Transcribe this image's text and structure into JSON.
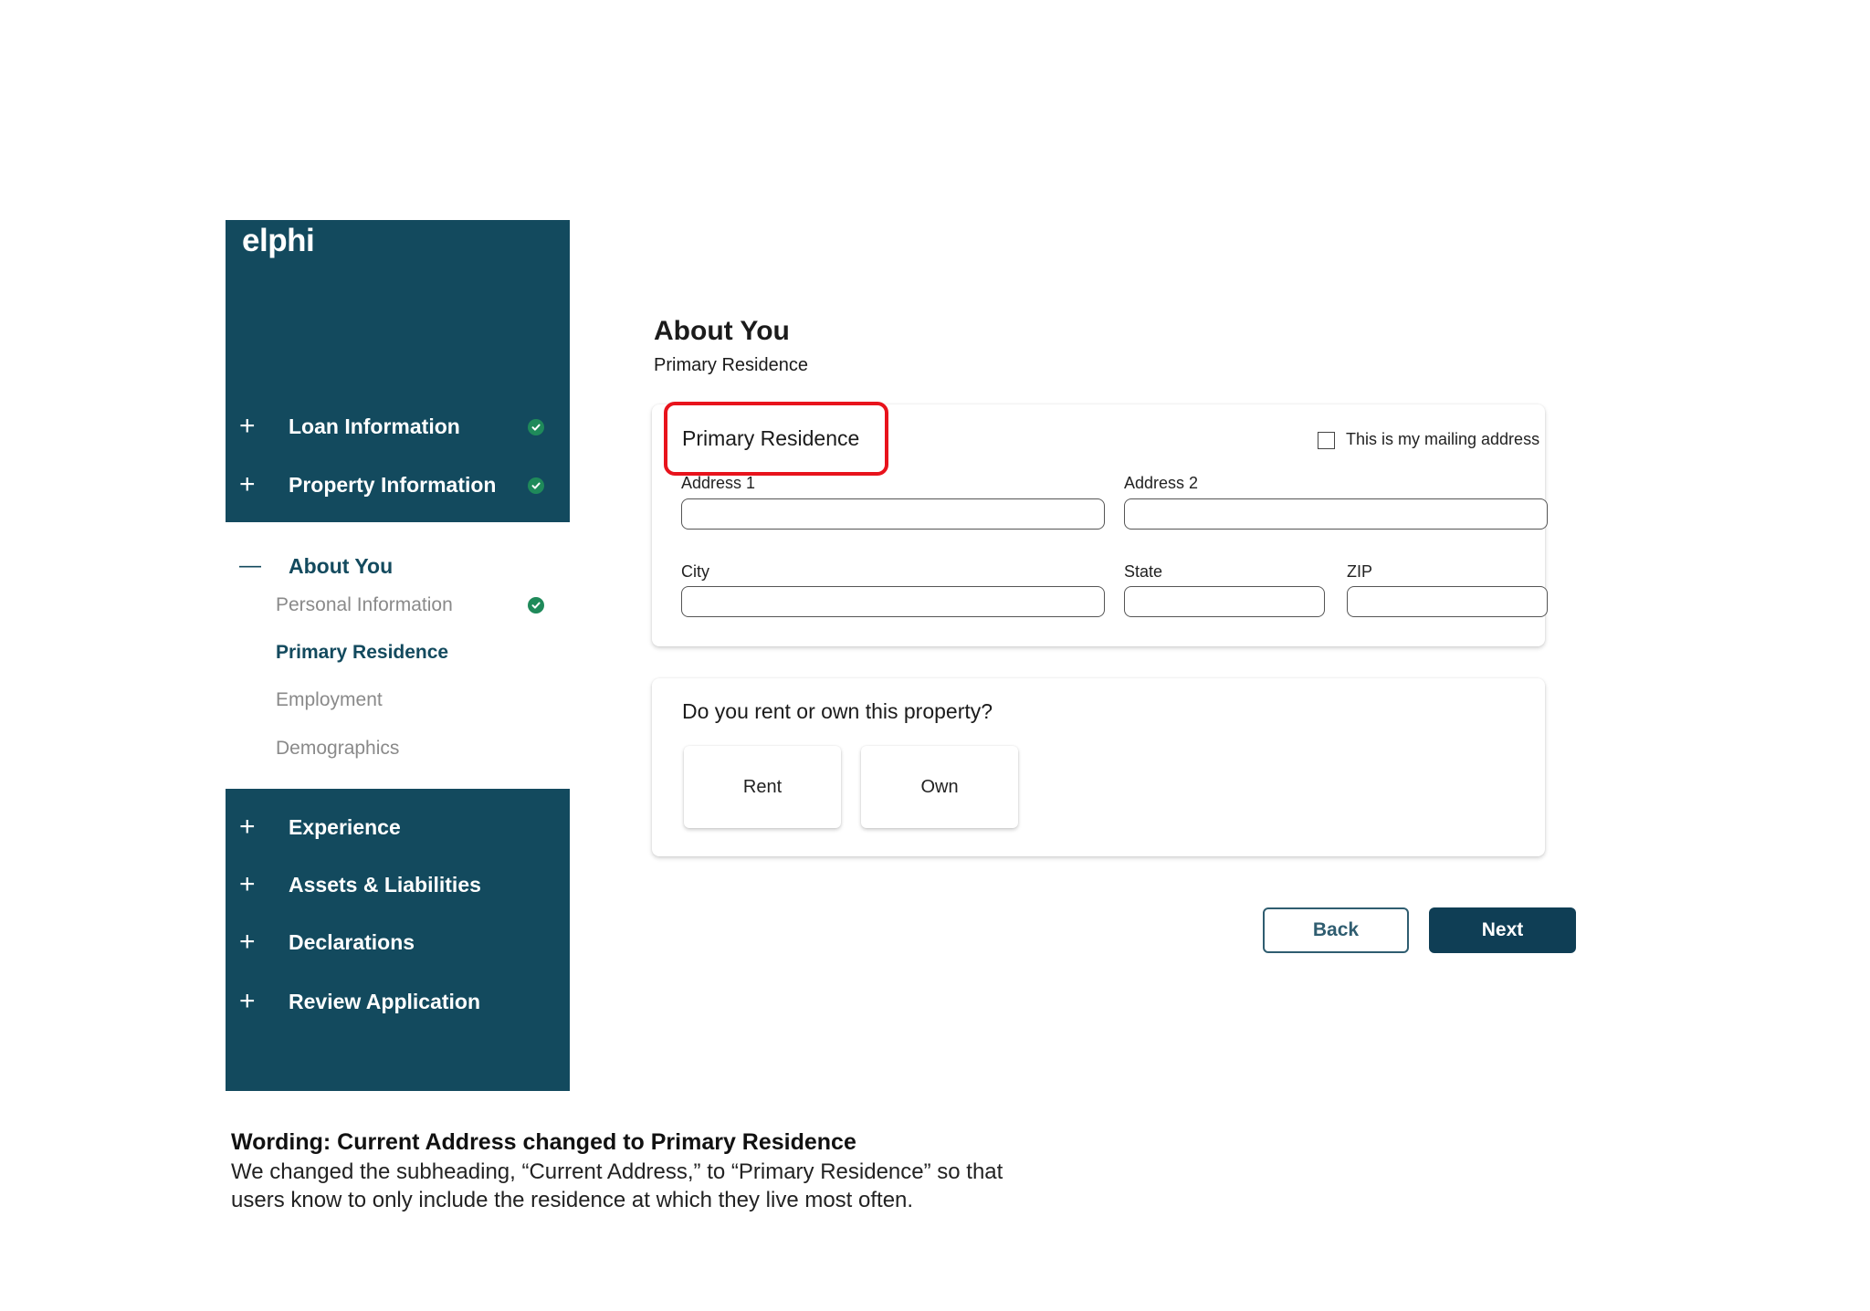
{
  "app": {
    "logo": "elphi"
  },
  "sidebar": {
    "top_items": [
      {
        "label": "Loan Information",
        "sign": "+",
        "completed": true
      },
      {
        "label": "Property Information",
        "sign": "+",
        "completed": true
      }
    ],
    "active_section": {
      "label": "About You",
      "sign": "—",
      "sub_items": [
        {
          "label": "Personal Information",
          "state": "completed"
        },
        {
          "label": "Primary Residence",
          "state": "active"
        },
        {
          "label": "Employment",
          "state": "pending"
        },
        {
          "label": "Demographics",
          "state": "pending"
        }
      ]
    },
    "bottom_items": [
      {
        "label": "Experience",
        "sign": "+"
      },
      {
        "label": "Assets & Liabilities",
        "sign": "+"
      },
      {
        "label": "Declarations",
        "sign": "+"
      },
      {
        "label": "Review Application",
        "sign": "+"
      }
    ]
  },
  "main": {
    "title": "About You",
    "subtitle": "Primary Residence",
    "address_card": {
      "title": "Primary Residence",
      "mailing_checkbox_label": "This is my mailing address",
      "mailing_checked": false,
      "fields": {
        "address1": {
          "label": "Address 1",
          "value": ""
        },
        "address2": {
          "label": "Address 2",
          "value": ""
        },
        "city": {
          "label": "City",
          "value": ""
        },
        "state": {
          "label": "State",
          "value": ""
        },
        "zip": {
          "label": "ZIP",
          "value": ""
        }
      }
    },
    "ownership_card": {
      "question": "Do you rent or own this property?",
      "options": [
        "Rent",
        "Own"
      ]
    },
    "buttons": {
      "back": "Back",
      "next": "Next"
    }
  },
  "annotation": {
    "title": "Wording: Current Address changed to Primary Residence",
    "body": "We changed the subheading, “Current Address,” to “Primary Residence” so that users know to only include the residence at which they live most often."
  },
  "colors": {
    "sidebar_bg": "#134a5e",
    "primary_button": "#0f3e55",
    "check_green": "#1f8a5a",
    "highlight_red": "#e8131c"
  }
}
